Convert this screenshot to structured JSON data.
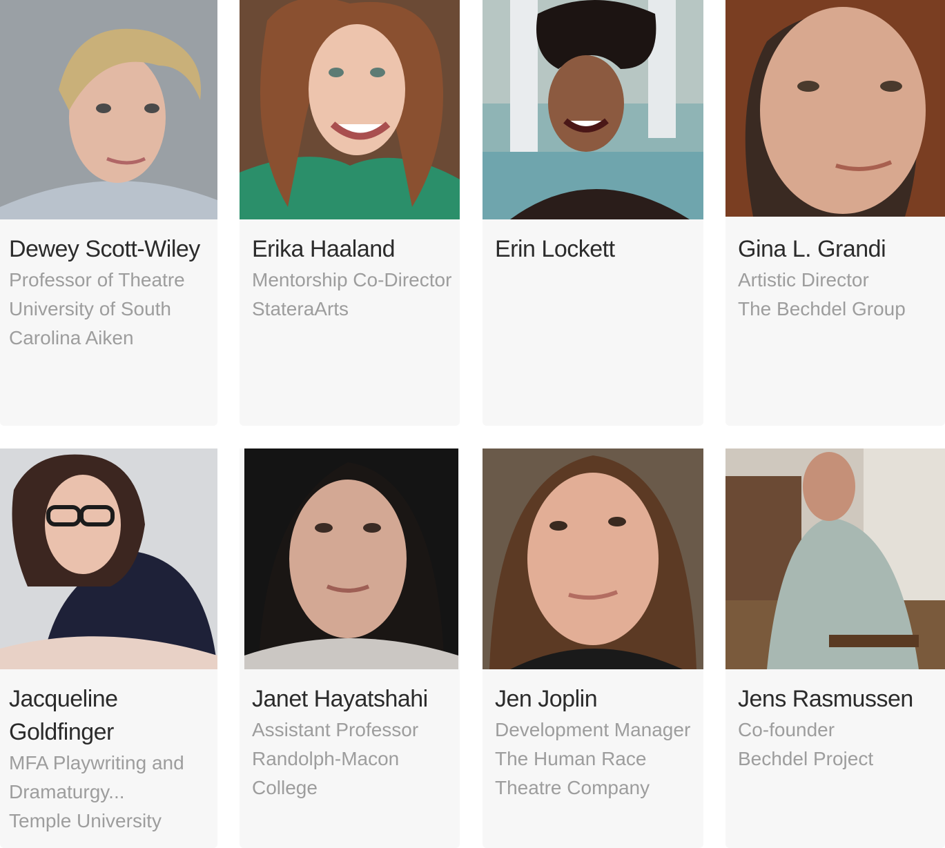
{
  "people": [
    {
      "name": "Dewey Scott-Wiley",
      "title": "Professor of Theatre",
      "organization": "University of South Carolina Aiken"
    },
    {
      "name": "Erika Haaland",
      "title": "Mentorship Co-Director",
      "organization": "StateraArts"
    },
    {
      "name": "Erin Lockett",
      "title": "",
      "organization": ""
    },
    {
      "name": "Gina L. Grandi",
      "title": "Artistic Director",
      "organization": "The Bechdel Group"
    },
    {
      "name": "Jacqueline Goldfinger",
      "title": "MFA Playwriting and Dramaturgy...",
      "organization": "Temple University"
    },
    {
      "name": "Janet Hayatshahi",
      "title": "Assistant Professor",
      "organization": "Randolph-Macon College"
    },
    {
      "name": "Jen Joplin",
      "title": "Development Manager",
      "organization": "The Human Race Theatre Company"
    },
    {
      "name": "Jens Rasmussen",
      "title": "Co-founder",
      "organization": "Bechdel Project"
    }
  ],
  "colors": {
    "card_background": "#f7f7f7",
    "name_text": "#2b2b2b",
    "detail_text": "#9d9d9d"
  }
}
